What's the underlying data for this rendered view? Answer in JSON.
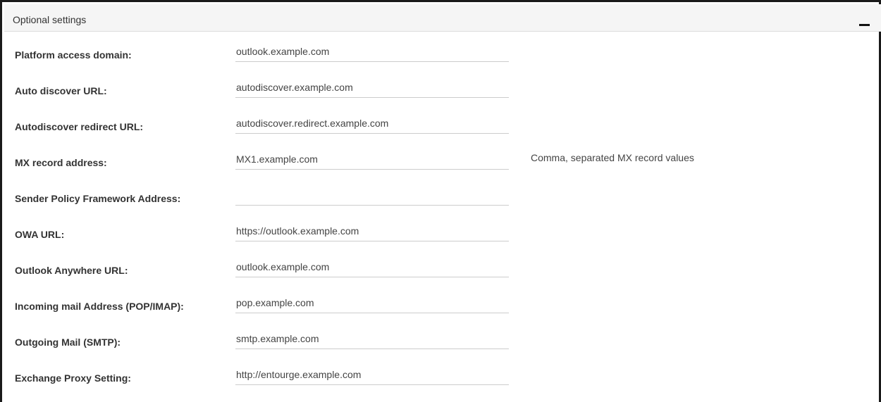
{
  "panel": {
    "title": "Optional settings",
    "collapse_icon": "minus-icon"
  },
  "fields": [
    {
      "label": "Platform access domain:",
      "value": "outlook.example.com"
    },
    {
      "label": "Auto discover URL:",
      "value": "autodiscover.example.com"
    },
    {
      "label": "Autodiscover redirect URL:",
      "value": "autodiscover.redirect.example.com"
    },
    {
      "label": "MX record address:",
      "value": "MX1.example.com",
      "help": "Comma, separated MX record values"
    },
    {
      "label": "Sender Policy Framework Address:",
      "value": ""
    },
    {
      "label": "OWA URL:",
      "value": "https://outlook.example.com"
    },
    {
      "label": "Outlook Anywhere URL:",
      "value": "outlook.example.com"
    },
    {
      "label": "Incoming mail Address (POP/IMAP):",
      "value": "pop.example.com"
    },
    {
      "label": "Outgoing Mail (SMTP):",
      "value": "smtp.example.com"
    },
    {
      "label": "Exchange Proxy Setting:",
      "value": "http://entourge.example.com"
    }
  ]
}
